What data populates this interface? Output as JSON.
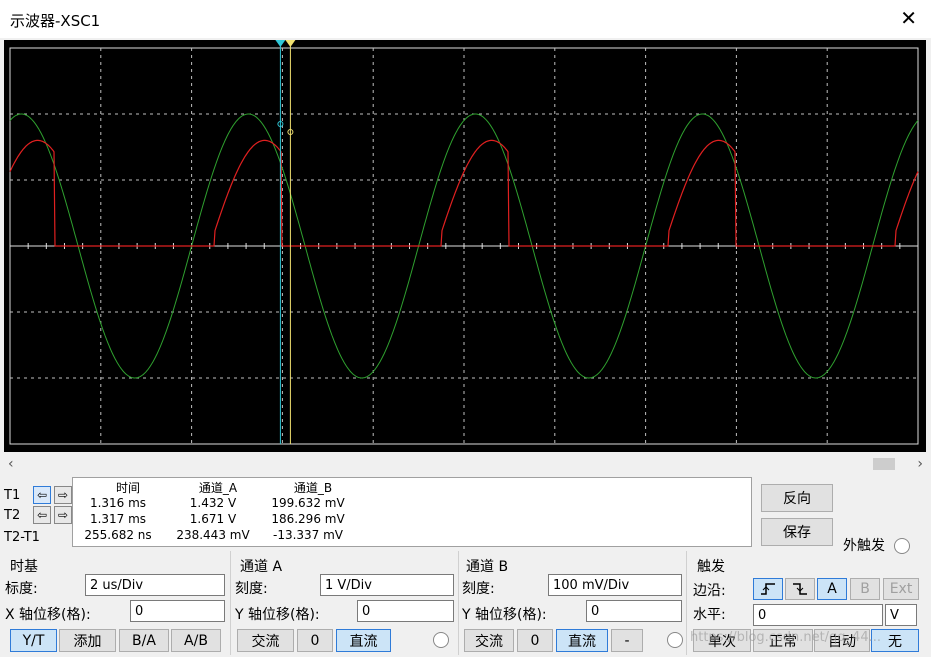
{
  "window": {
    "title": "示波器-XSC1",
    "close_icon": "close-icon"
  },
  "cursors": {
    "t1_label": "T1",
    "t2_label": "T2",
    "diff_label": "T2-T1"
  },
  "readout": {
    "headers": [
      "时间",
      "通道_A",
      "通道_B"
    ],
    "rows": [
      [
        "1.316 ms",
        "1.432 V",
        "199.632 mV"
      ],
      [
        "1.317 ms",
        "1.671 V",
        "186.296 mV"
      ],
      [
        "255.682 ns",
        "238.443 mV",
        "-13.337 mV"
      ]
    ]
  },
  "side_buttons": {
    "reverse": "反向",
    "save": "保存",
    "ext_trigger": "外触发"
  },
  "timebase": {
    "title": "时基",
    "scale_label": "标度:",
    "scale_value": "2 us/Div",
    "xpos_label": "X 轴位移(格):",
    "xpos_value": "0",
    "buttons": [
      "Y/T",
      "添加",
      "B/A",
      "A/B"
    ]
  },
  "channel_a": {
    "title": "通道 A",
    "scale_label": "刻度:",
    "scale_value": "1  V/Div",
    "ypos_label": "Y 轴位移(格):",
    "ypos_value": "0",
    "buttons": [
      "交流",
      "0",
      "直流"
    ]
  },
  "channel_b": {
    "title": "通道 B",
    "scale_label": "刻度:",
    "scale_value": "100 mV/Div",
    "ypos_label": "Y 轴位移(格):",
    "ypos_value": "0",
    "buttons": [
      "交流",
      "0",
      "直流",
      "-"
    ]
  },
  "trigger": {
    "title": "触发",
    "edge_label": "边沿:",
    "level_label": "水平:",
    "level_value": "0",
    "level_unit": "V",
    "source_buttons": [
      "A",
      "B",
      "Ext"
    ],
    "mode_buttons": [
      "单次",
      "正常",
      "自动",
      "无"
    ]
  },
  "watermark": "https://blog.csdn.net/qq_44...",
  "colors": {
    "channel_a": "#2fa02f",
    "channel_b": "#e02020",
    "cursor1": "#30c8d8",
    "cursor2": "#f0e070",
    "grid": "#c0c0c0"
  }
}
